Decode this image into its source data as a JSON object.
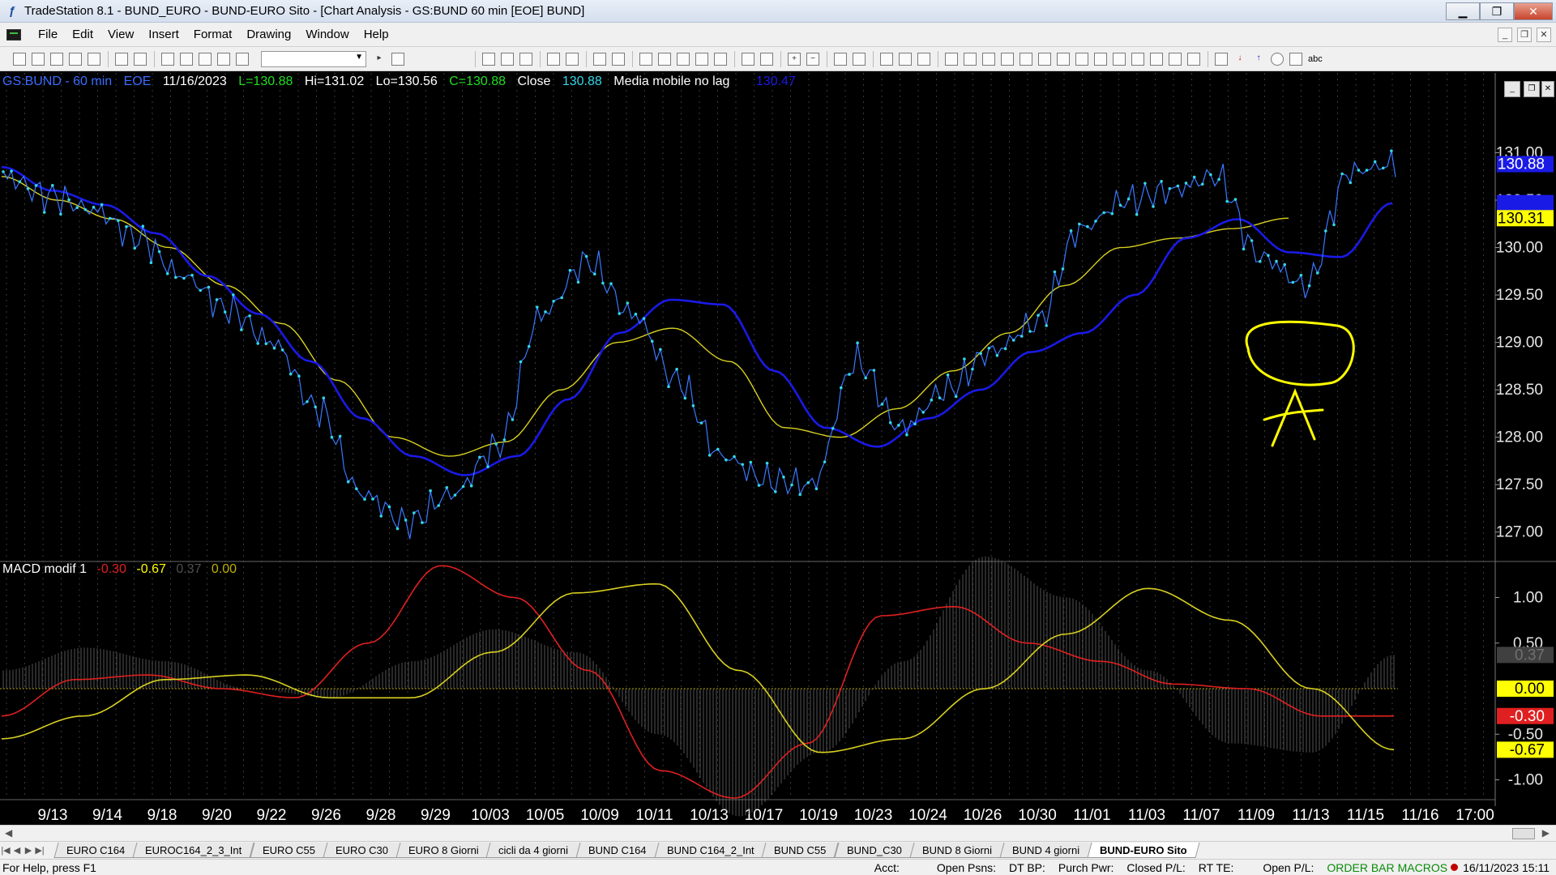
{
  "window": {
    "title": "TradeStation 8.1 - BUND_EURO - BUND-EURO Sito - [Chart Analysis - GS:BUND  60 min  [EOE] BUND]",
    "controls": [
      "▁",
      "❐",
      "✕"
    ]
  },
  "menu": [
    "File",
    "Edit",
    "View",
    "Insert",
    "Format",
    "Drawing",
    "Window",
    "Help"
  ],
  "toolbar": {
    "abc_label": "abc"
  },
  "chart_info": {
    "symbol": "GS:BUND - 60 min",
    "session": "EOE",
    "date": "11/16/2023",
    "last": "L=130.88",
    "high": "Hi=131.02",
    "low": "Lo=130.56",
    "close": "C=130.88",
    "close_label": "Close",
    "close_value": "130.88",
    "ma_label": "Media mobile no lag",
    "ma_value": "130.47"
  },
  "macd_info": {
    "label": "MACD modif 1",
    "v1": "-0.30",
    "v2": "-0.67",
    "v3": "0.37",
    "v4": "0.00"
  },
  "annotation": {
    "letter": "A",
    "color": "#ffff00"
  },
  "chart_data": [
    {
      "type": "line",
      "title": "",
      "xlabel": "",
      "ylabel": "",
      "x": [
        "9/13",
        "9/14",
        "9/18",
        "9/20",
        "9/22",
        "9/26",
        "9/28",
        "9/29",
        "10/03",
        "10/05",
        "10/09",
        "10/11",
        "10/13",
        "10/17",
        "10/19",
        "10/23",
        "10/24",
        "10/26",
        "10/30",
        "11/01",
        "11/03",
        "11/07",
        "11/09",
        "11/13",
        "11/15",
        "11/16",
        "17:00"
      ],
      "ylim": [
        126.75,
        131.5
      ],
      "yticks": [
        "127.00",
        "127.50",
        "128.00",
        "128.50",
        "129.00",
        "129.50",
        "130.00",
        "130.50",
        "131.00"
      ],
      "series": [
        {
          "name": "Close",
          "color": "#33d6e8",
          "values": [
            130.75,
            130.55,
            130.4,
            130.1,
            129.7,
            129.35,
            129.0,
            128.3,
            127.4,
            127.1,
            127.4,
            127.9,
            129.3,
            129.85,
            129.3,
            128.6,
            127.8,
            127.55,
            127.5,
            128.8,
            128.1,
            128.5,
            128.9,
            129.2,
            130.2,
            130.5,
            130.6,
            130.75,
            129.9,
            129.6,
            130.8,
            130.88
          ]
        },
        {
          "name": "Media mobile no lag",
          "color": "#1a1ae6",
          "values": [
            130.85,
            130.6,
            130.45,
            130.15,
            129.7,
            129.3,
            128.8,
            128.2,
            127.8,
            127.6,
            127.8,
            128.4,
            129.1,
            129.45,
            129.4,
            128.7,
            128.1,
            127.9,
            128.2,
            128.5,
            128.9,
            129.1,
            129.5,
            130.1,
            130.3,
            129.95,
            129.9,
            130.47
          ]
        },
        {
          "color": "#d8d020",
          "values": [
            130.75,
            130.5,
            130.3,
            130.0,
            129.6,
            129.2,
            128.6,
            128.0,
            127.8,
            127.95,
            128.5,
            129.0,
            129.15,
            128.8,
            128.1,
            128.0,
            128.3,
            128.7,
            129.1,
            129.6,
            130.0,
            130.1,
            130.2,
            130.31
          ]
        }
      ],
      "price_labels": [
        {
          "text": "130.88",
          "bg": "#1a1ae6",
          "fg": "#ffffff"
        },
        {
          "text": "130.47",
          "bg": "#1a1ae6",
          "fg": "#1a1ae6"
        },
        {
          "text": "130.31",
          "bg": "#ffff00",
          "fg": "#000000"
        }
      ]
    },
    {
      "type": "line",
      "title": "",
      "ylim": [
        -1.2,
        1.2
      ],
      "yticks": [
        "1.00",
        "0.50",
        "-0.50",
        "-1.00"
      ],
      "series": [
        {
          "color": "#e02020",
          "values": [
            -0.3,
            0.1,
            0.15,
            0.0,
            -0.1,
            0.5,
            1.35,
            1.0,
            0.2,
            -0.9,
            -1.2,
            -0.6,
            0.8,
            0.9,
            0.5,
            0.3,
            0.05,
            0.0,
            -0.3,
            -0.3
          ]
        },
        {
          "color": "#d8d020",
          "values": [
            -0.55,
            -0.3,
            0.1,
            0.15,
            -0.1,
            -0.1,
            0.4,
            1.05,
            1.15,
            0.2,
            -0.7,
            -0.55,
            0.0,
            0.6,
            1.1,
            0.75,
            0.0,
            -0.67
          ]
        },
        {
          "color": "#707070",
          "values": [
            0.2,
            0.45,
            0.3,
            0.0,
            -0.1,
            0.3,
            0.65,
            0.4,
            -0.5,
            -1.4,
            -0.7,
            0.3,
            1.45,
            1.0,
            0.2,
            -0.6,
            -0.7,
            0.37
          ]
        }
      ],
      "zero_line": "0.00",
      "price_labels": [
        {
          "text": "0.37",
          "bg": "#404040",
          "fg": "#707070"
        },
        {
          "text": "0.00",
          "bg": "#ffff00",
          "fg": "#000000"
        },
        {
          "text": "-0.30",
          "bg": "#e02020",
          "fg": "#ffffff"
        },
        {
          "text": "-0.67",
          "bg": "#ffff00",
          "fg": "#000000"
        }
      ]
    }
  ],
  "tabs": [
    "EURO C164",
    "EUROC164_2_3_Int",
    "EURO C55",
    "EURO C30",
    "EURO 8 Giorni",
    "cicli da 4 giorni",
    "BUND C164",
    "BUND C164_2_Int",
    "BUND C55",
    "BUND_C30",
    "BUND 8 Giorni",
    "BUND 4 giorni",
    "BUND-EURO Sito"
  ],
  "tab_nav": [
    "|◀",
    "◀",
    "▶",
    "▶|"
  ],
  "status": {
    "help": "For Help, press F1",
    "acct": "Acct:",
    "open_psns": "Open Psns:",
    "dt_bp": "DT BP:",
    "purch_pwr": "Purch Pwr:",
    "closed_pl": "Closed P/L:",
    "rt_te": "RT TE:",
    "open_pl": "Open P/L:",
    "orderbar": "ORDER BAR",
    "macros": "MACROS",
    "datetime": "16/11/2023 15:11"
  }
}
